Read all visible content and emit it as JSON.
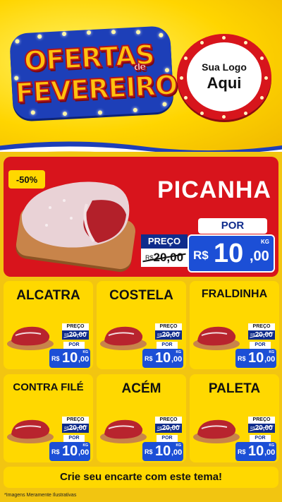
{
  "header": {
    "title_line1": "OFERTAS",
    "title_de": "de",
    "title_line2": "FEVEREIRO",
    "logo_line1": "Sua Logo",
    "logo_line2": "Aqui"
  },
  "featured": {
    "discount": "-50%",
    "name": "PICANHA",
    "price_label": "PREÇO",
    "old_currency": "R$",
    "old_value": "20,00",
    "por_label": "POR",
    "new_currency": "R$",
    "new_integer": "10",
    "new_decimal": ",00",
    "unit": "KG"
  },
  "products": [
    {
      "name": "ALCATRA",
      "price_label": "PREÇO",
      "old_currency": "R$",
      "old_value": "20,00",
      "por_label": "POR",
      "new_currency": "R$",
      "new_integer": "10",
      "new_decimal": ",00",
      "unit": "KG"
    },
    {
      "name": "COSTELA",
      "price_label": "PREÇO",
      "old_currency": "R$",
      "old_value": "20,00",
      "por_label": "POR",
      "new_currency": "R$",
      "new_integer": "10",
      "new_decimal": ",00",
      "unit": "KG"
    },
    {
      "name": "FRALDINHA",
      "price_label": "PREÇO",
      "old_currency": "R$",
      "old_value": "20,00",
      "por_label": "POR",
      "new_currency": "R$",
      "new_integer": "10",
      "new_decimal": ",00",
      "unit": "KG"
    },
    {
      "name": "CONTRA FILÉ",
      "price_label": "PREÇO",
      "old_currency": "R$",
      "old_value": "20,00",
      "por_label": "POR",
      "new_currency": "R$",
      "new_integer": "10",
      "new_decimal": ",00",
      "unit": "KG"
    },
    {
      "name": "ACÉM",
      "price_label": "PREÇO",
      "old_currency": "R$",
      "old_value": "20,00",
      "por_label": "POR",
      "new_currency": "R$",
      "new_integer": "10",
      "new_decimal": ",00",
      "unit": "KG"
    },
    {
      "name": "PALETA",
      "price_label": "PREÇO",
      "old_currency": "R$",
      "old_value": "20,00",
      "por_label": "POR",
      "new_currency": "R$",
      "new_integer": "10",
      "new_decimal": ",00",
      "unit": "KG"
    }
  ],
  "footer": {
    "cta": "Crie seu encarte com este tema!",
    "disclaimer": "*Imagens Meramente Ilustrativas"
  },
  "colors": {
    "background_yellow": "#f2c511",
    "card_yellow": "#ffd800",
    "featured_red": "#d8141c",
    "price_blue": "#1c4fd6",
    "label_navy": "#0f2c8c"
  },
  "icons": [
    "meat-cut-icon",
    "cutting-board-icon"
  ]
}
